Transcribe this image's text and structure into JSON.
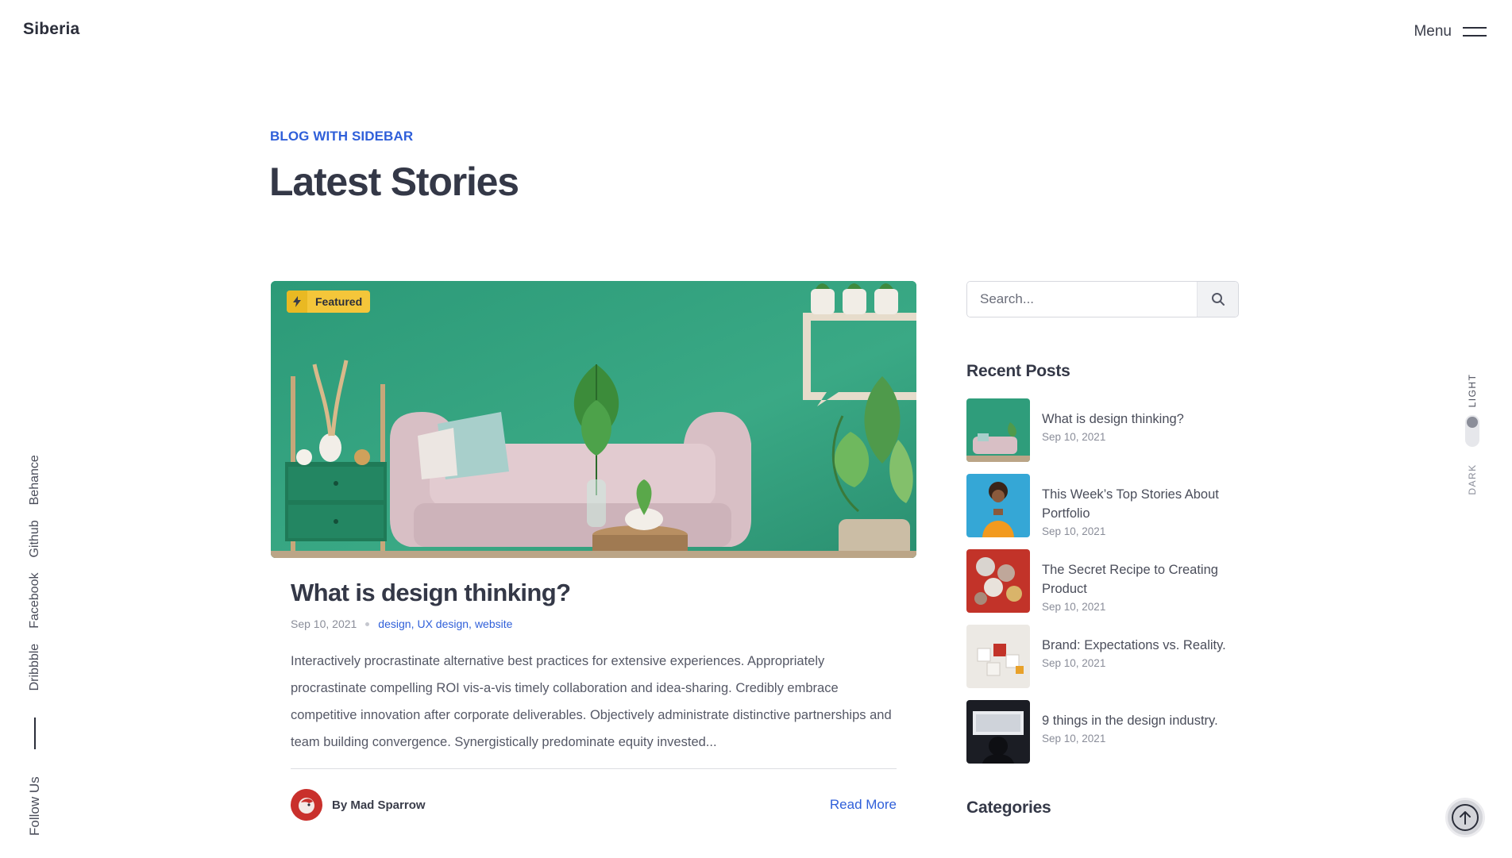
{
  "header": {
    "logo": "Siberia",
    "menu_label": "Menu"
  },
  "hero": {
    "eyebrow": "BLOG WITH SIDEBAR",
    "title": "Latest Stories"
  },
  "social": {
    "follow_label": "Follow Us",
    "networks": [
      "Dribbble",
      "Facebook",
      "Github",
      "Behance"
    ]
  },
  "theme_switch": {
    "light_label": "LIGHT",
    "dark_label": "DARK",
    "selected": "LIGHT"
  },
  "featured_post": {
    "badge": "Featured",
    "title": "What is design thinking?",
    "date": "Sep 10, 2021",
    "tags": [
      "design",
      "UX design",
      "website"
    ],
    "excerpt": "Interactively procrastinate alternative best practices for extensive experiences. Appropriately procrastinate compelling ROI vis-a-vis timely collaboration and idea-sharing. Credibly embrace competitive innovation after corporate deliverables. Objectively administrate distinctive partnerships and team building convergence. Synergistically predominate equity invested...",
    "author": "By Mad Sparrow",
    "read_more": "Read More"
  },
  "sidebar": {
    "search_placeholder": "Search...",
    "recent_heading": "Recent Posts",
    "recent_posts": [
      {
        "title": "What is design thinking?",
        "date": "Sep 10, 2021"
      },
      {
        "title": "This Week’s Top Stories About Portfolio",
        "date": "Sep 10, 2021"
      },
      {
        "title": "The Secret Recipe to Creating Product",
        "date": "Sep 10, 2021"
      },
      {
        "title": "Brand: Expectations vs. Reality.",
        "date": "Sep 10, 2021"
      },
      {
        "title": "9 things in the design industry.",
        "date": "Sep 10, 2021"
      }
    ],
    "categories_heading": "Categories"
  },
  "colors": {
    "accent": "#2f5fd9",
    "heading": "#343847",
    "badge": "#f4c63a"
  }
}
